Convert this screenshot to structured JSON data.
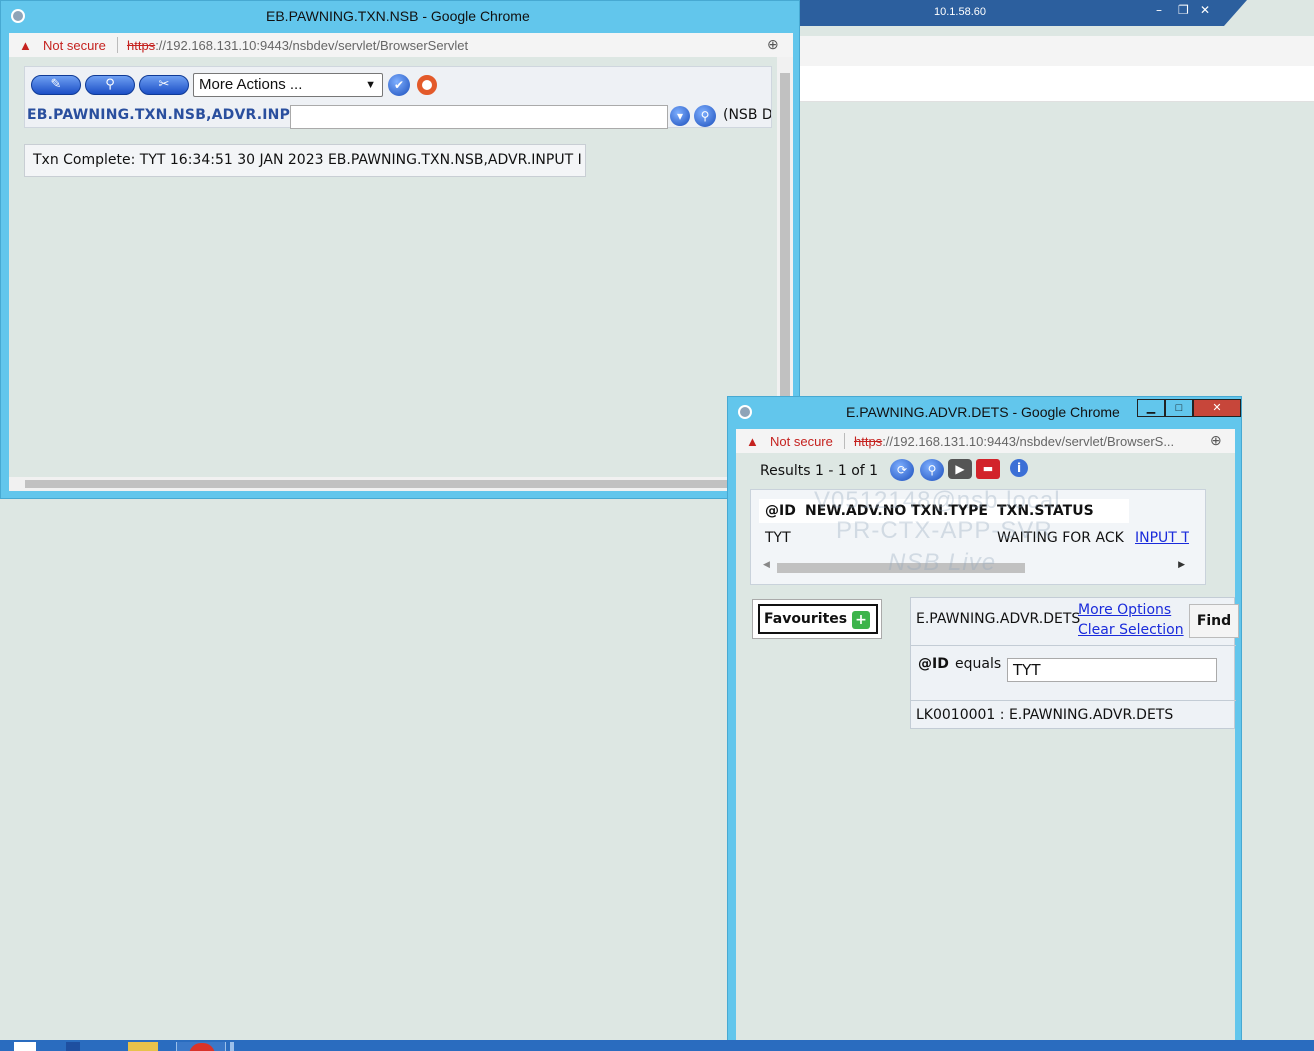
{
  "remote_bar": {
    "ip": "10.1.58.60"
  },
  "window1": {
    "title": "EB.PAWNING.TXN.NSB - Google Chrome",
    "address": {
      "security": "Not secure",
      "protocol": "https",
      "url_rest": "://192.168.131.10:9443/nsbdev/servlet/BrowserServlet"
    },
    "toolbar": {
      "more_actions_label": "More Actions ...",
      "version_label": "EB.PAWNING.TXN.NSB,ADVR.INPUT",
      "version_input_value": "",
      "company_hint": "(NSB D"
    },
    "message": "Txn Complete: TYT 16:34:51 30 JAN 2023 EB.PAWNING.TXN.NSB,ADVR.INPUT I"
  },
  "window2": {
    "title": "E.PAWNING.ADVR.DETS - Google Chrome",
    "address": {
      "security": "Not secure",
      "protocol": "https",
      "url_rest": "://192.168.131.10:9443/nsbdev/servlet/BrowserS..."
    },
    "results_label": "Results 1 - 1 of 1",
    "grid": {
      "columns": [
        "@ID",
        "NEW.ADV.NO",
        "TXN.TYPE",
        "TXN.STATUS"
      ],
      "rows": [
        {
          "id": "TYT",
          "new_adv_no": "",
          "txn_type": "",
          "txn_status": "WAITING FOR ACK",
          "action": "INPUT T"
        }
      ]
    },
    "watermark": {
      "line1": "V0512148@nsb.local",
      "line2": "PR-CTX-APP-SVR",
      "line3": "NSB Live"
    },
    "favourites_label": "Favourites",
    "selection": {
      "enquiry_name": "E.PAWNING.ADVR.DETS",
      "more_options": "More Options",
      "clear_selection": "Clear Selection",
      "find_label": "Find",
      "field": "@ID",
      "operand": "equals",
      "value": "TYT",
      "footer": "LK0010001 : E.PAWNING.ADVR.DETS"
    }
  }
}
